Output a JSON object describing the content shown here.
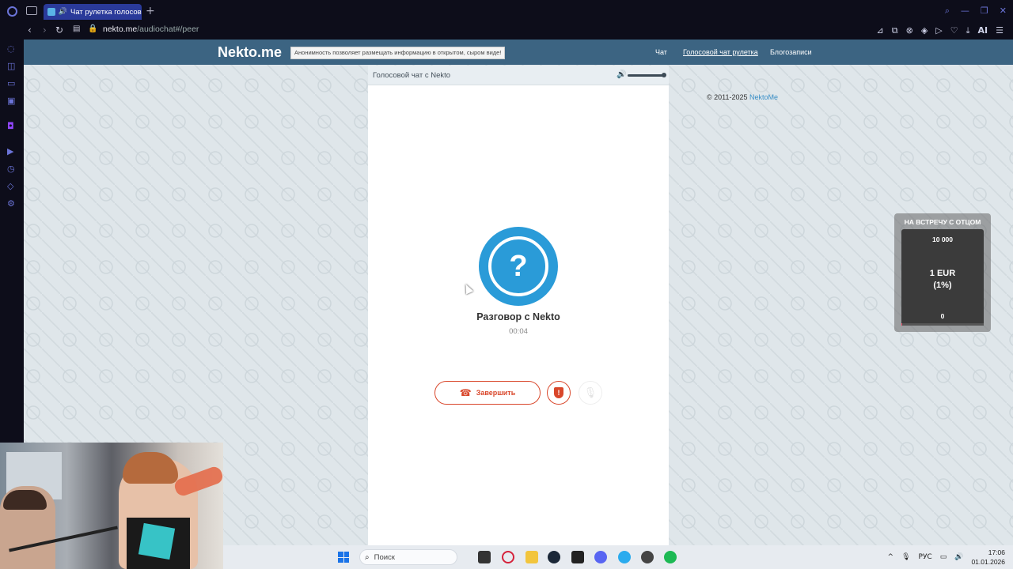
{
  "browser": {
    "tab_title": "Чат рулетка голосовая",
    "new_tab": "+",
    "url_domain": "nekto.me",
    "url_path": "/audiochat#/peer",
    "ai_label": "AI",
    "nav_icons": [
      "back-icon",
      "forward-icon",
      "reload-icon",
      "easy-setup-icon",
      "lock-icon"
    ],
    "sidebar_icons": [
      "aria-icon",
      "bag-icon",
      "messenger-icon",
      "maps-icon",
      "twitch-icon",
      "player-icon",
      "history-icon",
      "extensions-icon",
      "settings-icon"
    ]
  },
  "site": {
    "brand": "Nekto.me",
    "tagline": "Анонимность позволяет размещать информацию в открытом, сыром виде!",
    "nav": [
      {
        "label": "Чат",
        "active": false
      },
      {
        "label": "Голосовой чат рулетка",
        "active": true
      },
      {
        "label": "Блогозаписи",
        "active": false
      }
    ],
    "copyright_prefix": "© 2011-2025",
    "copyright_link": "NektoMe"
  },
  "chat": {
    "header_label": "Голосовой чат с Nekto",
    "volume_level": 1.0,
    "avatar_glyph": "?",
    "peer_name": "Разговор с Nekto",
    "timer": "00:04",
    "end_button": "Завершить"
  },
  "donation": {
    "title": "НА ВСТРЕЧУ С ОТЦОМ",
    "goal": "10 000",
    "amount_line1": "1 EUR",
    "amount_line2": "(1%)",
    "start": "0",
    "progress": 0.01
  },
  "taskbar": {
    "search_placeholder": "Поиск",
    "lang": "РУС",
    "time": "17:06",
    "date": "01.01.2026"
  },
  "colors": {
    "accent": "#2a9bd8",
    "danger": "#d9472b",
    "header": "#3c6482"
  }
}
